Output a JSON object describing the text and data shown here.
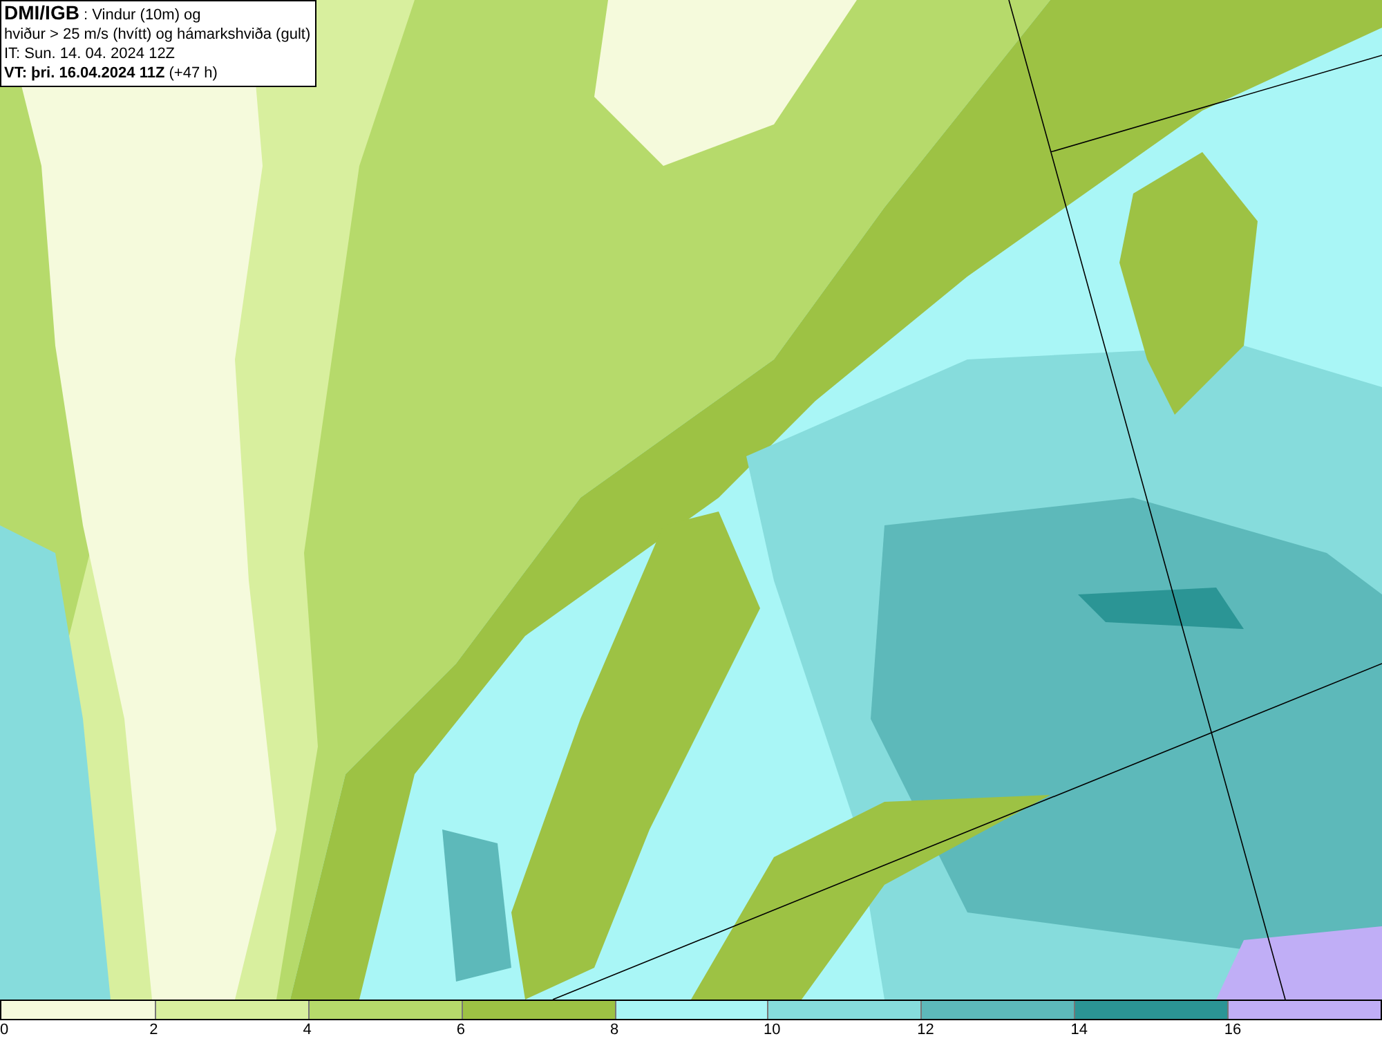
{
  "info_box": {
    "lines": [
      "**DMI/IGB** : Vindur (10m) og",
      "hviður > 25 m/s (hvítt) og hámarkshviða (gult)",
      "IT: Sun. 14. 04. 2024 12Z",
      "**VT: þri. 16.04.2024 11Z** (+47 h)"
    ]
  },
  "legend": {
    "bins": [
      {
        "label": "0",
        "color": "#f5fadc"
      },
      {
        "label": "2",
        "color": "#d8ef9e"
      },
      {
        "label": "4",
        "color": "#b6da6b"
      },
      {
        "label": "6",
        "color": "#9dc244"
      },
      {
        "label": "8",
        "color": "#a9f6f6"
      },
      {
        "label": "10",
        "color": "#86dcdc"
      },
      {
        "label": "12",
        "color": "#5db9ba"
      },
      {
        "label": "14",
        "color": "#2b9595"
      },
      {
        "label": "16",
        "color": "#c0aef6"
      }
    ]
  }
}
